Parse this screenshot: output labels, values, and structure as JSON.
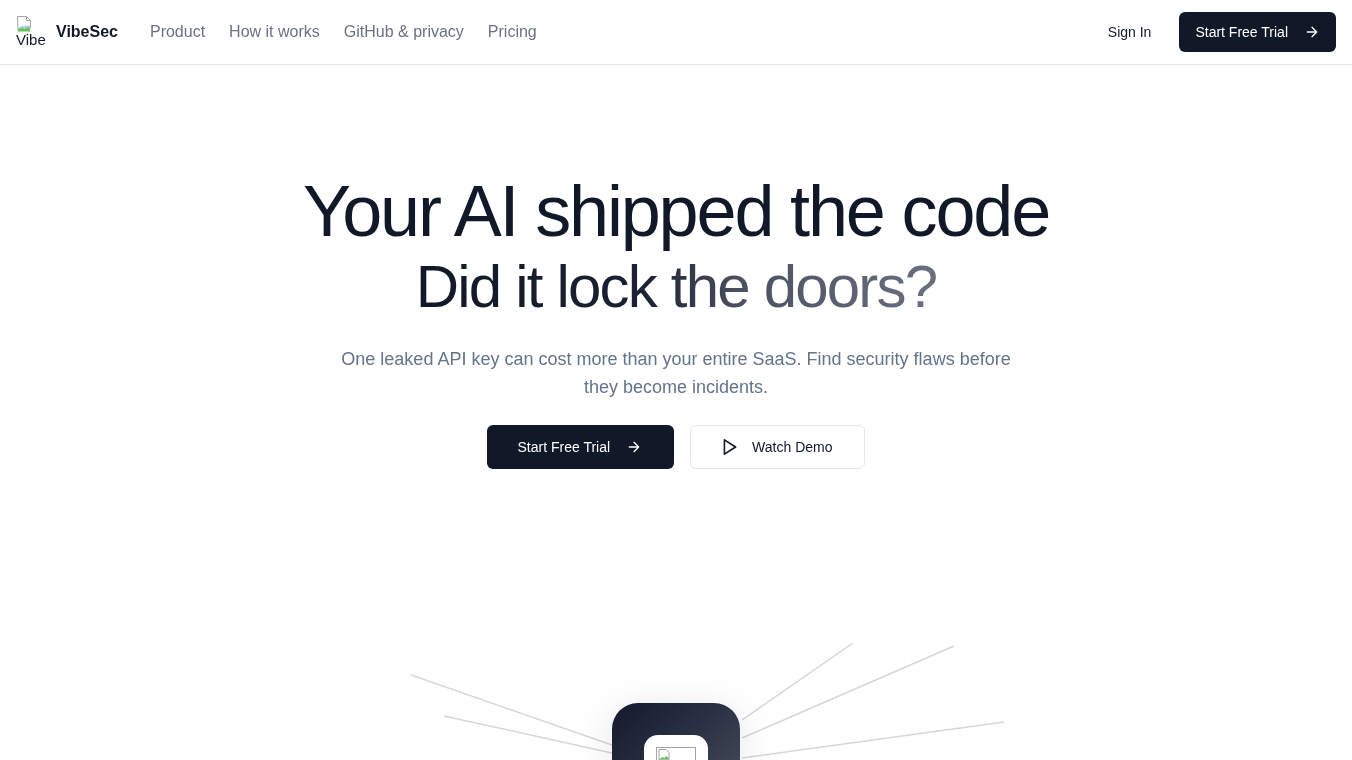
{
  "header": {
    "logo_alt": "Vibe",
    "brand": "VibeSec",
    "nav": [
      "Product",
      "How it works",
      "GitHub & privacy",
      "Pricing"
    ],
    "sign_in": "Sign In",
    "cta": "Start Free Trial"
  },
  "hero": {
    "title": "Your AI shipped the code",
    "subtitle": "Did it lock the doors?",
    "description": "One leaked API key can cost more than your entire SaaS. Find security flaws before they become incidents.",
    "buttons": [
      {
        "label": "Start Free Trial",
        "kind": "primary"
      },
      {
        "label": "Watch Demo",
        "kind": "secondary"
      }
    ]
  }
}
